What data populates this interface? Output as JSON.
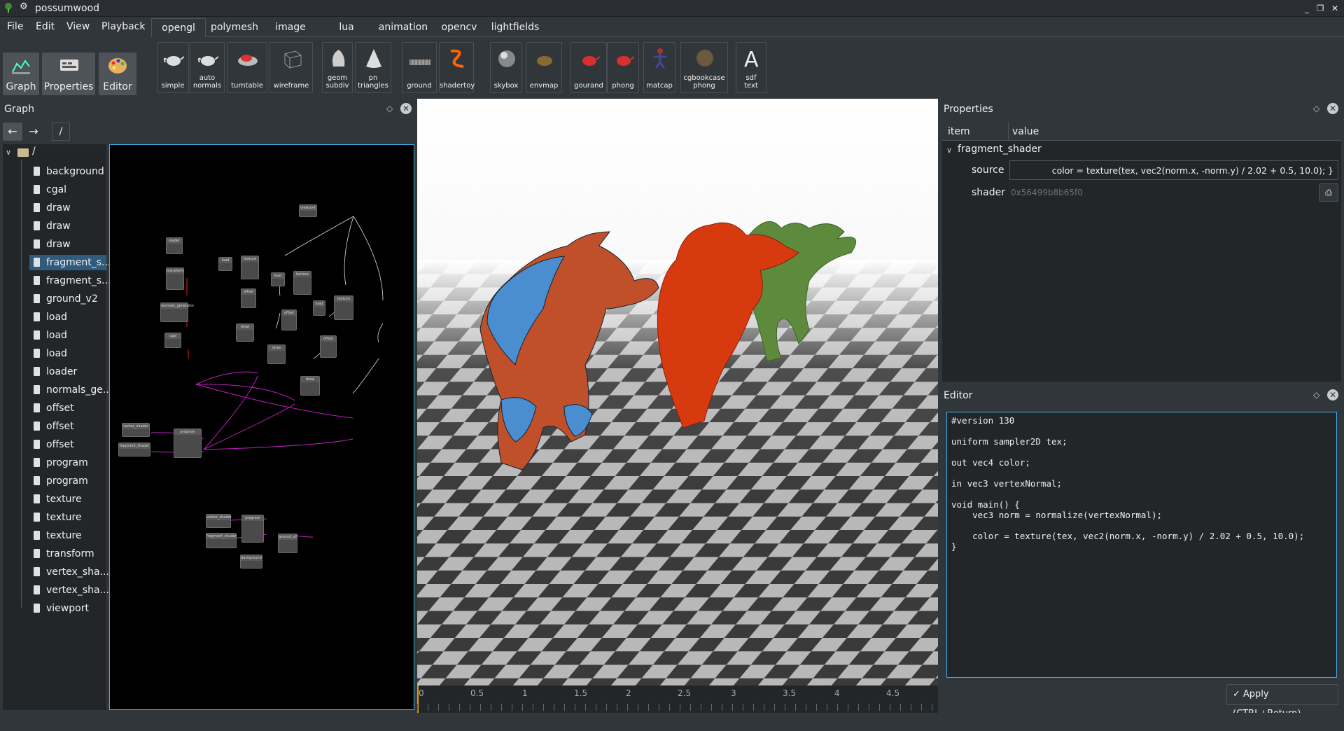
{
  "window": {
    "title": "possumwood"
  },
  "menu": [
    "File",
    "Edit",
    "View",
    "Playback"
  ],
  "tabs": [
    "opengl",
    "polymesh",
    "image",
    "lua",
    "animation",
    "opencv",
    "lightfields"
  ],
  "active_tab": "opengl",
  "big_buttons": [
    "Graph",
    "Properties",
    "Editor"
  ],
  "shelf": [
    {
      "label": "simple",
      "icon": "teapot-icon"
    },
    {
      "label": "auto\nnormals",
      "icon": "teapot-icon"
    },
    {
      "label": "turntable",
      "icon": "car-icon"
    },
    {
      "label": "wireframe",
      "icon": "wireframe-cube-icon"
    },
    {
      "label": "geom\nsubdiv",
      "icon": "shape-icon"
    },
    {
      "label": "pn\ntriangles",
      "icon": "cone-icon"
    },
    {
      "label": "ground",
      "icon": "ground-icon"
    },
    {
      "label": "shadertoy",
      "icon": "shadertoy-icon"
    },
    {
      "label": "skybox",
      "icon": "sphere-icon"
    },
    {
      "label": "envmap",
      "icon": "envmap-icon"
    },
    {
      "label": "gourand",
      "icon": "teapot-red-icon"
    },
    {
      "label": "phong",
      "icon": "teapot-red-icon"
    },
    {
      "label": "matcap",
      "icon": "figure-icon"
    },
    {
      "label": "cgbookcase\nphong",
      "icon": "stone-sphere-icon"
    },
    {
      "label": "sdf\ntext",
      "icon": "letter-a-icon"
    }
  ],
  "graph_panel": {
    "title": "Graph",
    "path": "/",
    "root": "/",
    "tree": [
      "background",
      "cgal",
      "draw",
      "draw",
      "draw",
      "fragment_s...",
      "fragment_s...",
      "ground_v2",
      "load",
      "load",
      "load",
      "loader",
      "normals_ge...",
      "offset",
      "offset",
      "offset",
      "program",
      "program",
      "texture",
      "texture",
      "texture",
      "transform",
      "vertex_sha...",
      "vertex_sha...",
      "viewport"
    ],
    "selected_index": 5
  },
  "graph_nodes": [
    {
      "label": "viewport"
    },
    {
      "label": "loader"
    },
    {
      "label": "transform"
    },
    {
      "label": "normals_generator"
    },
    {
      "label": "cgal"
    },
    {
      "label": "load"
    },
    {
      "label": "texture"
    },
    {
      "label": "offset"
    },
    {
      "label": "draw"
    },
    {
      "label": "load"
    },
    {
      "label": "texture"
    },
    {
      "label": "offset"
    },
    {
      "label": "draw"
    },
    {
      "label": "load"
    },
    {
      "label": "texture"
    },
    {
      "label": "offset"
    },
    {
      "label": "draw"
    },
    {
      "label": "vertex_shader"
    },
    {
      "label": "fragment_shader"
    },
    {
      "label": "program"
    },
    {
      "label": "vertex_shader"
    },
    {
      "label": "fragment_shader"
    },
    {
      "label": "program"
    },
    {
      "label": "ground_v2"
    },
    {
      "label": "background"
    }
  ],
  "timeline": [
    "0",
    "0.5",
    "1",
    "1.5",
    "2",
    "2.5",
    "3",
    "3.5",
    "4",
    "4.5"
  ],
  "properties": {
    "title": "Properties",
    "col_item": "item",
    "col_value": "value",
    "group": "fragment_shader",
    "source_label": "source",
    "source_value": "color = texture(tex, vec2(norm.x, -norm.y) / 2.02 + 0.5, 10.0); }",
    "shader_label": "shader",
    "shader_value": "0x56499b8b65f0"
  },
  "editor": {
    "title": "Editor",
    "code": "#version 130\n\nuniform sampler2D tex;\n\nout vec4 color;\n\nin vec3 vertexNormal;\n\nvoid main() {\n    vec3 norm = normalize(vertexNormal);\n\n    color = texture(tex, vec2(norm.x, -norm.y) / 2.02 + 0.5, 10.0);\n}",
    "apply_label": "Apply (CTRL+Return)"
  },
  "colors": {
    "accent": "#3daee9",
    "bg": "#31363b",
    "selection": "#2f5b7d"
  }
}
